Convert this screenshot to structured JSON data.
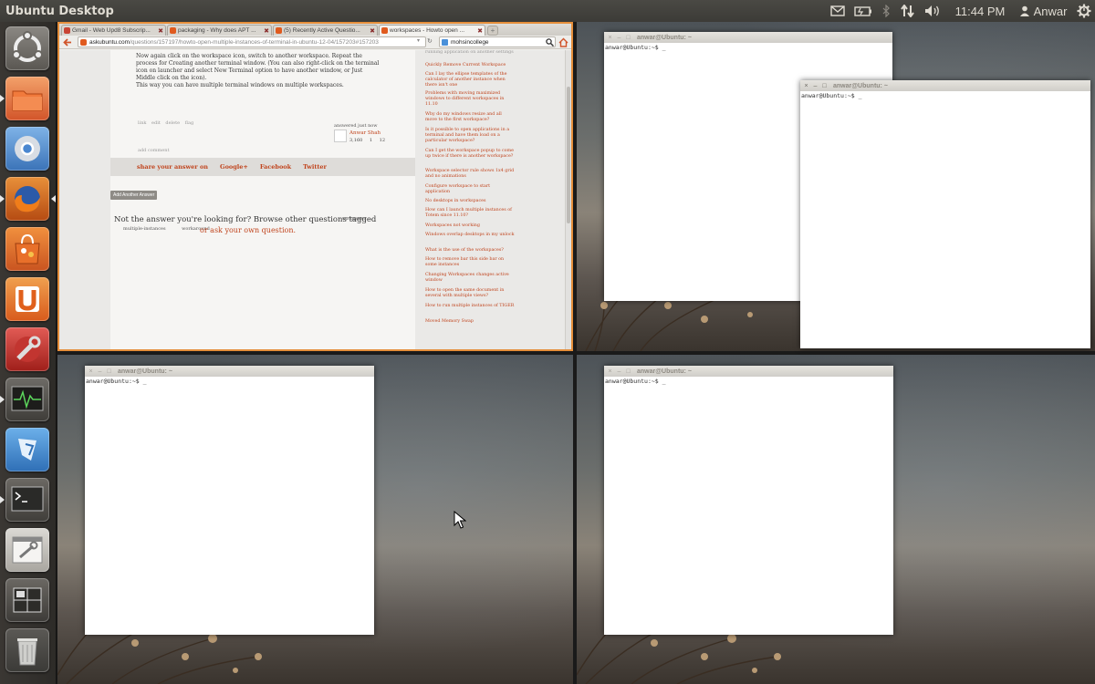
{
  "panel": {
    "title": "Ubuntu Desktop",
    "time": "11:44 PM",
    "user": "Anwar",
    "indicators": [
      "mail-icon",
      "battery-icon",
      "bluetooth-icon",
      "network-icon",
      "volume-icon",
      "session-gear-icon"
    ]
  },
  "launcher": {
    "items": [
      {
        "name": "dash-home-button",
        "icon": "ubuntu-logo-icon"
      },
      {
        "name": "files-button",
        "icon": "folder-icon"
      },
      {
        "name": "chromium-button",
        "icon": "chromium-icon"
      },
      {
        "name": "firefox-button",
        "icon": "firefox-icon"
      },
      {
        "name": "software-center-button",
        "icon": "shopping-bag-icon"
      },
      {
        "name": "ubuntu-one-button",
        "icon": "ubuntu-one-icon"
      },
      {
        "name": "system-settings-button",
        "icon": "settings-wrench-icon"
      },
      {
        "name": "system-monitor-button",
        "icon": "system-monitor-icon"
      },
      {
        "name": "app-launcher-button",
        "icon": "launcher-app-icon"
      },
      {
        "name": "terminal-button",
        "icon": "terminal-icon"
      },
      {
        "name": "ccsm-button",
        "icon": "compiz-settings-icon"
      },
      {
        "name": "workspace-switcher-button",
        "icon": "workspace-switcher-icon"
      },
      {
        "name": "trash-button",
        "icon": "trash-icon"
      }
    ]
  },
  "browser": {
    "tabs": [
      {
        "label": "Gmail - Web Upd8 Subscrip...",
        "fav_color": "#c84434",
        "active": false
      },
      {
        "label": "packaging - Why does APT ...",
        "fav_color": "#e05a1e",
        "active": false
      },
      {
        "label": "(5) Recently Active Questio...",
        "fav_color": "#e05a1e",
        "active": false
      },
      {
        "label": "workspaces - Howto open ...",
        "fav_color": "#e05a1e",
        "active": true
      }
    ],
    "url_host": "askubuntu.com",
    "url_path": "/questions/157197/howto-open-multiple-instances-of-terminal-in-ubuntu-12-04/157203#157203",
    "search_value": "mohsincollege",
    "answer": {
      "paragraph1": "Now again click on the workspace icon, switch to another workspace. Repeat the process for Creating another terminal window. (You can also right-click on the terminal icon on launcher and select New Terminal option to have another window, or Just Middle click on the icon).",
      "paragraph2": "This way you can have multiple terminal windows on multiple workspaces.",
      "post_links": "link edit delete flag",
      "answered_label": "answered just now",
      "user_name": "Anwar Shah",
      "user_rep": "3,160 1 12",
      "add_comment": "add comment"
    },
    "share": {
      "label": "share your answer on",
      "google": "Google+",
      "facebook": "Facebook",
      "twitter": "Twitter"
    },
    "add_another_answer": "Add Another Answer",
    "not_answer": "Not the answer you're looking for? Browse other questions tagged",
    "tags": [
      "workspaces",
      "multiple-instances",
      "workaround"
    ],
    "ask_own": "or ask your own question.",
    "related": [
      "running application on another settings",
      "Quickly Remove Current Workspace",
      "Can I lay the ellipse templates of the calculator of another instance when there isn't one",
      "Problems with moving maximized windows to different workspaces in 11.10",
      "Why do my windows resize and all move to the first workspace?",
      "Is it possible to open applications in a terminal and have them load on a particular workspace?",
      "Can I get the workspace popup to come up twice if there is another workspace?",
      "Workspace selector rule shows 1x4 grid and no animations",
      "Configure workspace to start application",
      "No desktops in workspaces",
      "How can I launch multiple instances of Totem since 11.10?",
      "Workspaces not working",
      "Windows overlap desktops in my unlock",
      "What is the use of the workspaces?",
      "How to remove bar this side bar on some instances",
      "Changing Workspaces changes active window",
      "How to open the same document in several with multiple views?",
      "How to run multiple instances of TIGER",
      "Moved Memory Swap"
    ]
  },
  "terminals": [
    {
      "title": "anwar@Ubuntu: ~",
      "prompt": "anwar@Ubuntu:~$ _"
    },
    {
      "title": "anwar@Ubuntu: ~",
      "prompt": "anwar@Ubuntu:~$ _"
    },
    {
      "title": "anwar@Ubuntu: ~",
      "prompt": "anwar@Ubuntu:~$ _"
    },
    {
      "title": "anwar@Ubuntu: ~",
      "prompt": "anwar@Ubuntu:~$ _"
    }
  ],
  "colors": {
    "accent_orange": "#e58e3a",
    "link_red": "#c0441d",
    "panel_bg": "#3c3b37"
  }
}
